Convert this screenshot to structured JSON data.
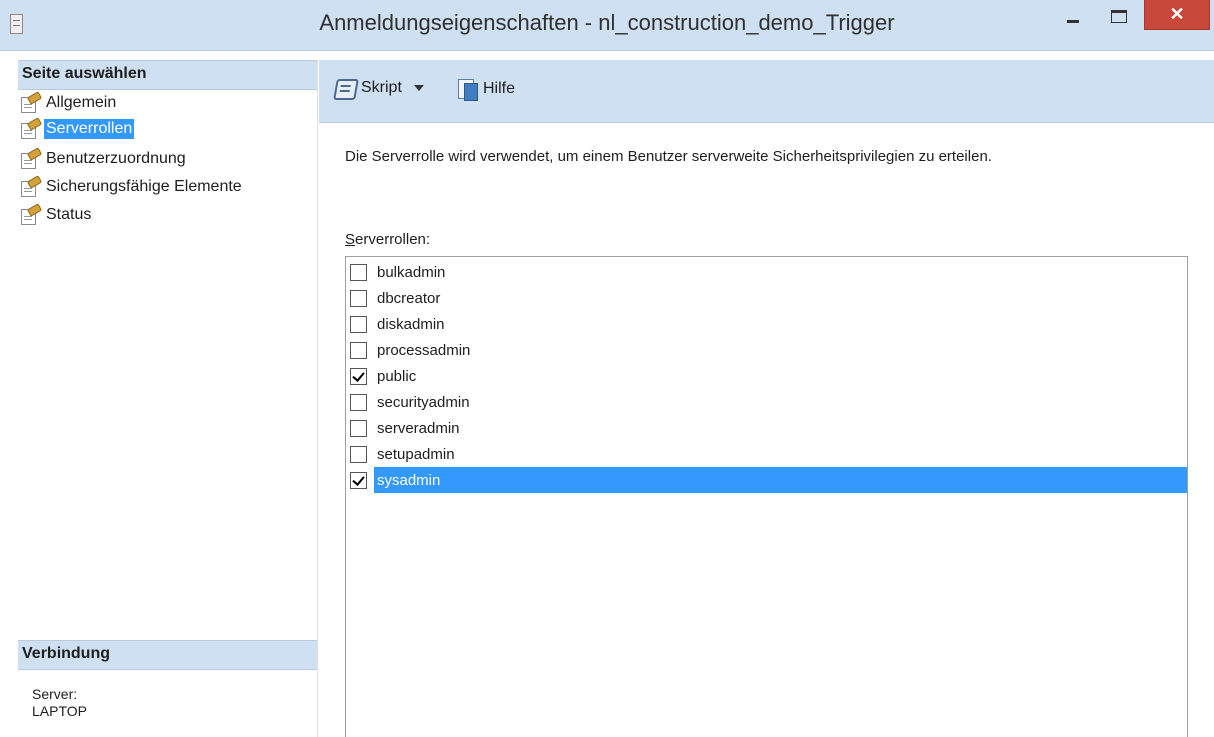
{
  "window": {
    "title": "Anmeldungseigenschaften - nl_construction_demo_Trigger",
    "minimize_icon": "minimize-icon",
    "maximize_icon": "maximize-icon",
    "close_label": "✕"
  },
  "sidebar": {
    "header": "Seite auswählen",
    "items": [
      {
        "label": "Allgemein",
        "icon": "page-icon",
        "selected": false
      },
      {
        "label": "Serverrollen",
        "icon": "page-icon",
        "selected": true
      },
      {
        "label": "Benutzerzuordnung",
        "icon": "page-icon",
        "selected": false
      },
      {
        "label": "Sicherungsfähige Elemente",
        "icon": "page-icon",
        "selected": false
      },
      {
        "label": "Status",
        "icon": "page-icon",
        "selected": false
      }
    ],
    "connection": {
      "header": "Verbindung",
      "server_label": "Server:",
      "server_value": "LAPTOP"
    }
  },
  "toolbar": {
    "script_label": "Skript",
    "help_label": "Hilfe"
  },
  "main": {
    "description": "Die Serverrolle wird verwendet, um einem Benutzer serverweite Sicherheitsprivilegien zu erteilen.",
    "roles_label_accesskey": "S",
    "roles_label_rest": "erverrollen:",
    "roles": [
      {
        "name": "bulkadmin",
        "checked": false
      },
      {
        "name": "dbcreator",
        "checked": false
      },
      {
        "name": "diskadmin",
        "checked": false
      },
      {
        "name": "processadmin",
        "checked": false
      },
      {
        "name": "public",
        "checked": true
      },
      {
        "name": "securityadmin",
        "checked": false
      },
      {
        "name": "serveradmin",
        "checked": false
      },
      {
        "name": "setupadmin",
        "checked": false
      },
      {
        "name": "sysadmin",
        "checked": true,
        "selected": true
      }
    ]
  },
  "colors": {
    "selection": "#3399ff",
    "chrome": "#cfe0f2",
    "close_button": "#c7483a"
  }
}
